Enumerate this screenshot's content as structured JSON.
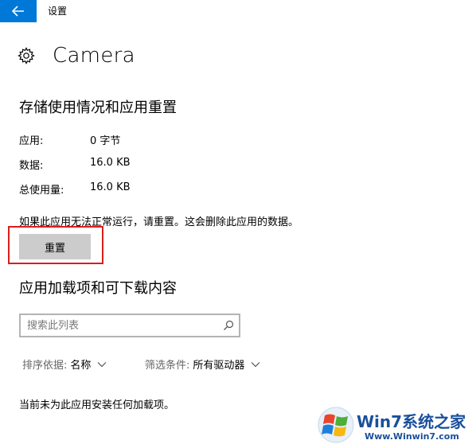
{
  "window": {
    "title": "设置"
  },
  "page": {
    "title": "Camera"
  },
  "storage": {
    "heading": "存储使用情况和应用重置",
    "rows": [
      {
        "label": "应用:",
        "value": "0 字节"
      },
      {
        "label": "数据:",
        "value": "16.0 KB"
      },
      {
        "label": "总使用量:",
        "value": "16.0 KB"
      }
    ],
    "notice": "如果此应用无法正常运行，请重置。这会删除此应用的数据。",
    "reset_label": "重置"
  },
  "addons": {
    "heading": "应用加载项和可下载内容",
    "search_placeholder": "搜索此列表",
    "sort": {
      "label": "排序依据:",
      "value": "名称"
    },
    "filter": {
      "label": "筛选条件:",
      "value": "所有驱动器"
    },
    "empty_text": "当前未为此应用安装任何加载项。"
  },
  "watermark": {
    "brand": "Win7系统之家",
    "url": "Www.Winwin7.com"
  },
  "colors": {
    "accent": "#0078d7",
    "highlight": "#d81e1e",
    "button": "#cccccc"
  },
  "icons": [
    "back-arrow-icon",
    "gear-icon",
    "search-icon",
    "chevron-down-icon",
    "windows-logo-icon"
  ]
}
